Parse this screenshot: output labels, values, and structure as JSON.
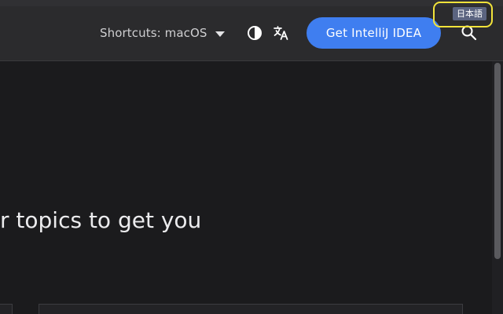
{
  "header": {
    "shortcuts_label": "Shortcuts: macOS",
    "cta_label": "Get IntelliJ IDEA",
    "language_badge": "日本語"
  },
  "hero": {
    "text": "r topics to get you"
  },
  "icons": {
    "shortcuts_dropdown": "chevron-down-icon",
    "theme": "contrast-icon",
    "translate": "translate-icon",
    "search": "search-icon"
  },
  "colors": {
    "background": "#1b1b1d",
    "header": "#2b2b2d",
    "accent": "#3f7ef0",
    "highlight": "#f2e33a",
    "badge": "#5b6480"
  }
}
